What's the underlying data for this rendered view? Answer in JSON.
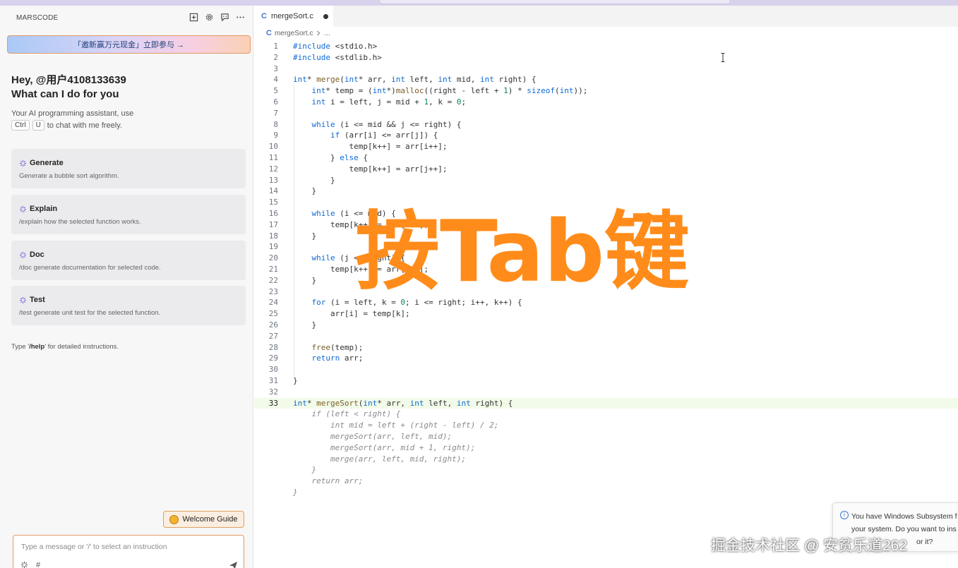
{
  "sidebar": {
    "title": "MARSCODE",
    "banner": "「邀新赢万元现金」立即参与 →",
    "greeting_line1": "Hey, @用户4108133639",
    "greeting_line2": "What can I do for you",
    "desc_line1": "Your AI programming assistant, use",
    "key1": "Ctrl",
    "key2": "U",
    "desc_line2_tail": "to chat with me freely.",
    "cards": [
      {
        "title": "Generate",
        "desc": "Generate a bubble sort algorithm."
      },
      {
        "title": "Explain",
        "desc": "/explain how the selected function works."
      },
      {
        "title": "Doc",
        "desc": "/doc generate documentation for selected code."
      },
      {
        "title": "Test",
        "desc": "/test generate unit test for the selected function."
      }
    ],
    "help_prefix": "Type '",
    "help_cmd": "/help",
    "help_suffix": "' for detailed instructions.",
    "welcome_guide": "Welcome Guide",
    "chat_placeholder": "Type a message or '/' to select an instruction",
    "chat_hash": "#"
  },
  "editor": {
    "tab_label": "mergeSort.c",
    "tab_icon": "C",
    "breadcrumb_file": "mergeSort.c",
    "breadcrumb_more": "...",
    "line_numbers": [
      "1",
      "2",
      "3",
      "4",
      "5",
      "6",
      "7",
      "8",
      "9",
      "10",
      "11",
      "12",
      "13",
      "14",
      "15",
      "16",
      "17",
      "18",
      "19",
      "20",
      "21",
      "22",
      "23",
      "24",
      "25",
      "26",
      "27",
      "28",
      "29",
      "30",
      "31",
      "32",
      "33"
    ],
    "lines": [
      "#include <stdio.h>",
      "#include <stdlib.h>",
      "",
      "int* merge(int* arr, int left, int mid, int right) {",
      "    int* temp = (int*)malloc((right - left + 1) * sizeof(int));",
      "    int i = left, j = mid + 1, k = 0;",
      "",
      "    while (i <= mid && j <= right) {",
      "        if (arr[i] <= arr[j]) {",
      "            temp[k++] = arr[i++];",
      "        } else {",
      "            temp[k++] = arr[j++];",
      "        }",
      "    }",
      "",
      "    while (i <= mid) {",
      "        temp[k++] = arr[i++];",
      "    }",
      "",
      "    while (j <= right) {",
      "        temp[k++] = arr[j++];",
      "    }",
      "",
      "    for (i = left, k = 0; i <= right; i++, k++) {",
      "        arr[i] = temp[k];",
      "    }",
      "",
      "    free(temp);",
      "    return arr;",
      "",
      "}",
      "",
      "int* mergeSort(int* arr, int left, int right) {"
    ],
    "ghost_lines": [
      "    if (left < right) {",
      "        int mid = left + (right - left) / 2;",
      "        mergeSort(arr, left, mid);",
      "        mergeSort(arr, mid + 1, right);",
      "        merge(arr, left, mid, right);",
      "    }",
      "    return arr;",
      "}"
    ]
  },
  "overlay_text": "按Tab键",
  "notification": {
    "line1": "You have Windows Subsystem f",
    "line2": "your system. Do you want to ins",
    "line3": "or it?"
  },
  "watermark": "掘金技术社区 @ 安贫乐道262",
  "colors": {
    "accent_orange": "#ff8c1a",
    "banner_border": "#e39a62",
    "keyword_blue": "#0e6ad6",
    "function_brown": "#795e26"
  }
}
